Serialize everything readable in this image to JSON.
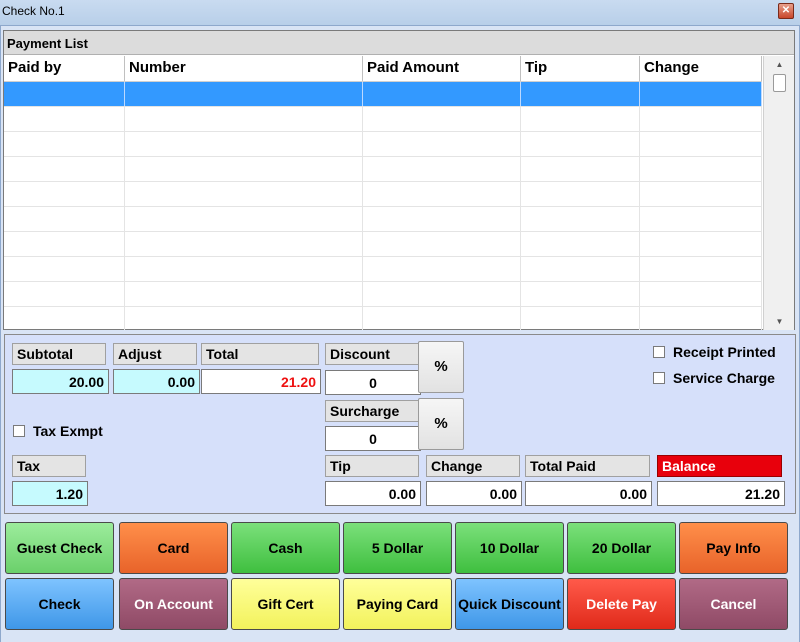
{
  "window": {
    "title": "Check No.1"
  },
  "payment_list": {
    "title": "Payment List",
    "columns": [
      "Paid by",
      "Number",
      "Paid Amount",
      "Tip",
      "Change"
    ]
  },
  "totals": {
    "subtotal_label": "Subtotal",
    "subtotal": "20.00",
    "adjust_label": "Adjust",
    "adjust": "0.00",
    "total_label": "Total",
    "total": "21.20",
    "discount_label": "Discount",
    "discount": "0",
    "surcharge_label": "Surcharge",
    "surcharge": "0",
    "percent": "%",
    "tax_exempt_label": "Tax Exmpt",
    "tax_label": "Tax",
    "tax": "1.20",
    "tip_label": "Tip",
    "tip": "0.00",
    "change_label": "Change",
    "change": "0.00",
    "total_paid_label": "Total Paid",
    "total_paid": "0.00",
    "balance_label": "Balance",
    "balance": "21.20",
    "receipt_printed_label": "Receipt Printed",
    "service_charge_label": "Service Charge",
    "total_color": "#e11111",
    "balance_color": "#e8000c"
  },
  "buttons": {
    "row1": [
      "Guest Check",
      "Card",
      "Cash",
      "5 Dollar",
      "10 Dollar",
      "20 Dollar",
      "Pay Info"
    ],
    "row2": [
      "Check",
      "On Account",
      "Gift Cert",
      "Paying Card",
      "Quick Discount",
      "Delete Pay",
      "Cancel"
    ]
  },
  "icons": {
    "close": "close-icon"
  }
}
